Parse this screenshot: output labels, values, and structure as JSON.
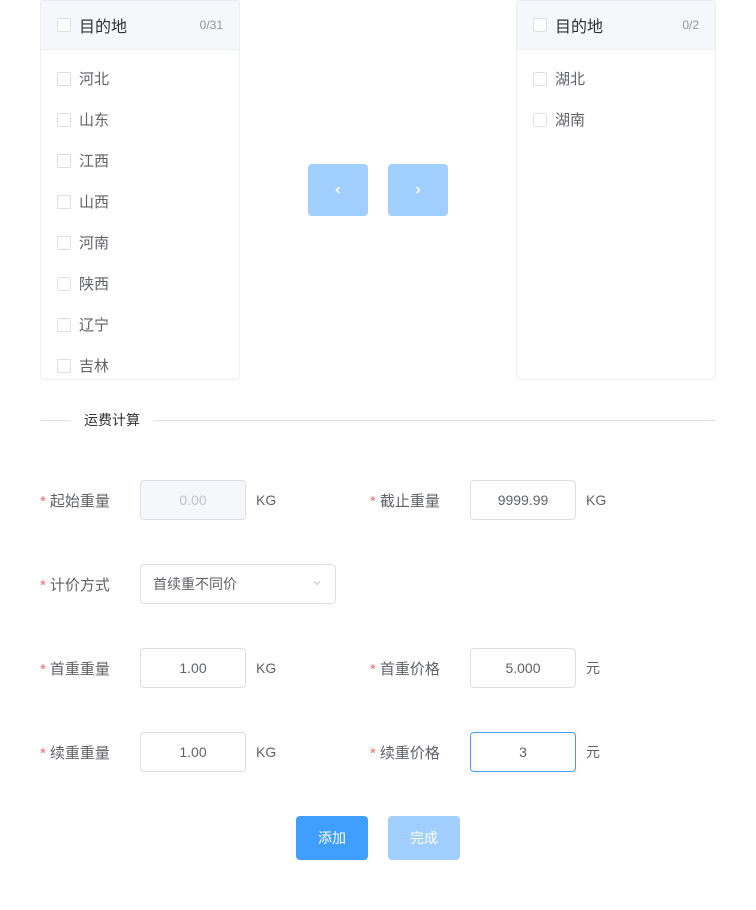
{
  "leftPanel": {
    "title": "目的地",
    "count": "0/31",
    "items": [
      "河北",
      "山东",
      "江西",
      "山西",
      "河南",
      "陕西",
      "辽宁",
      "吉林"
    ]
  },
  "rightPanel": {
    "title": "目的地",
    "count": "0/2",
    "items": [
      "湖北",
      "湖南"
    ]
  },
  "sectionTitle": "运费计算",
  "fields": {
    "startWeight": {
      "label": "起始重量",
      "value": "0.00",
      "unit": "KG"
    },
    "endWeight": {
      "label": "截止重量",
      "value": "9999.99",
      "unit": "KG"
    },
    "pricingMethod": {
      "label": "计价方式",
      "value": "首续重不同价"
    },
    "firstWeight": {
      "label": "首重重量",
      "value": "1.00",
      "unit": "KG"
    },
    "firstPrice": {
      "label": "首重价格",
      "value": "5.000",
      "unit": "元"
    },
    "contWeight": {
      "label": "续重重量",
      "value": "1.00",
      "unit": "KG"
    },
    "contPrice": {
      "label": "续重价格",
      "value": "3",
      "unit": "元"
    }
  },
  "buttons": {
    "add": "添加",
    "done": "完成"
  }
}
